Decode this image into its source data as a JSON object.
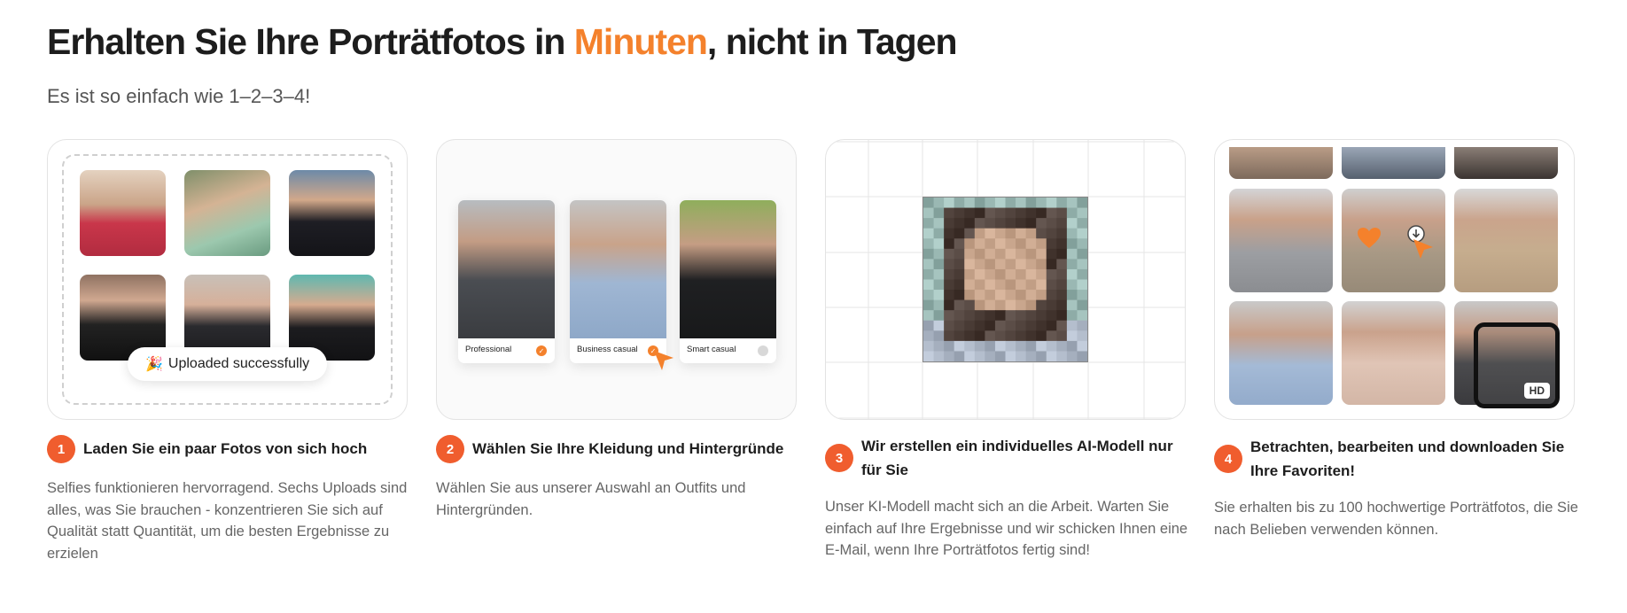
{
  "header": {
    "title_part1": "Erhalten Sie Ihre Porträtfotos in ",
    "title_accent": "Minuten",
    "title_part2": ", nicht in Tagen",
    "subtitle": "Es ist so einfach wie 1–2–3–4!"
  },
  "colors": {
    "accent": "#f4812c",
    "step_badge": "#f05d2e",
    "title_text": "#1d1d1d",
    "body_text": "#666666"
  },
  "card1": {
    "toast_icon": "party-popper-icon",
    "toast_emoji": "🎉",
    "toast_text": "Uploaded successfully"
  },
  "card2": {
    "outfits": [
      {
        "label": "Professional",
        "selected": true
      },
      {
        "label": "Business casual",
        "selected": true
      },
      {
        "label": "Smart casual",
        "selected": false
      }
    ],
    "check_glyph": "✓"
  },
  "card4": {
    "hd_label": "HD"
  },
  "steps": [
    {
      "number": "1",
      "title": "Laden Sie ein paar Fotos von sich hoch",
      "description": "Selfies funktionieren hervorragend. Sechs Uploads sind alles, was Sie brauchen - konzentrieren Sie sich auf Qualität statt Quantität, um die besten Ergebnisse zu erzielen"
    },
    {
      "number": "2",
      "title": "Wählen Sie Ihre Kleidung und Hintergründe",
      "description": "Wählen Sie aus unserer Auswahl an Outfits und Hintergründen."
    },
    {
      "number": "3",
      "title": "Wir erstellen ein individuelles AI-Modell nur für Sie",
      "description": "Unser KI-Modell macht sich an die Arbeit. Warten Sie einfach auf Ihre Ergebnisse und wir schicken Ihnen eine E-Mail, wenn Ihre Porträtfotos fertig sind!"
    },
    {
      "number": "4",
      "title": "Betrachten, bearbeiten und downloaden Sie Ihre Favoriten!",
      "description": "Sie erhalten bis zu 100 hochwertige Porträtfotos, die Sie nach Belieben verwenden können."
    }
  ]
}
